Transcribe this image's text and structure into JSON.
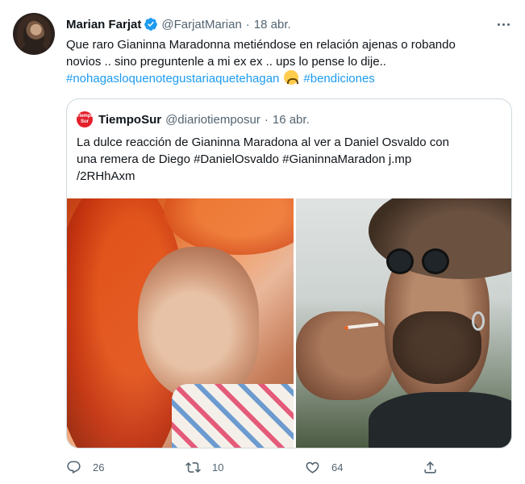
{
  "tweet": {
    "author_name": "Marian Farjat",
    "author_handle": "@FarjatMarian",
    "separator": "·",
    "date": "18 abr.",
    "text_line1": "Que raro Gianinna Maradonna metiéndose en relación ajenas o robando",
    "text_line2": "novios .. sino preguntenle a mi ex ex .. ups lo pense lo dije..",
    "hashtag1": "#nohagasloquenotegustariaquetehagan",
    "hashtag2": "#bendiciones",
    "emoji": "upside-down-face"
  },
  "quote": {
    "logo_line1": "Tiempo",
    "logo_line2": "Sur",
    "author_name": "TiempoSur",
    "author_handle": "@diariotiemposur",
    "separator": "·",
    "date": "16 abr.",
    "text_line1": "La dulce reacción de Gianinna Maradona al ver a Daniel Osvaldo con",
    "text_line2": "una remera de Diego #DanielOsvaldo #GianinnaMaradon j.mp",
    "text_line3": "/2RHhAxm"
  },
  "actions": {
    "replies": "26",
    "retweets": "10",
    "likes": "64"
  },
  "colors": {
    "text_primary": "#0f1419",
    "text_secondary": "#536471",
    "link": "#1d9bf0",
    "border": "#cfd9de",
    "verified": "#1d9bf0"
  },
  "icons": [
    "verified-badge-icon",
    "more-options-icon",
    "reply-icon",
    "retweet-icon",
    "like-icon",
    "share-icon",
    "emoji-upside-down-face"
  ]
}
